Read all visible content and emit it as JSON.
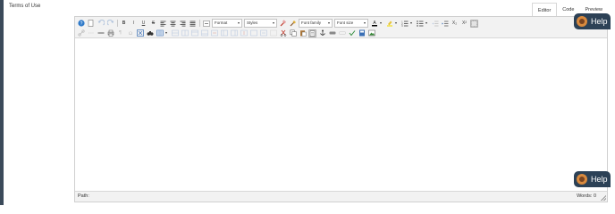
{
  "page": {
    "title": "Terms of Use"
  },
  "tabs": [
    {
      "label": "Editor",
      "active": true
    },
    {
      "label": "Code",
      "active": false
    },
    {
      "label": "Preview",
      "active": false
    }
  ],
  "toolbar": {
    "format_label": "Format",
    "styles_label": "Styles",
    "font_family_label": "Font family",
    "font_size_label": "Font size",
    "bold": "B",
    "italic": "I",
    "underline": "U",
    "strike": "S",
    "subscript": "X₂",
    "superscript": "X²",
    "paragraph": "¶"
  },
  "status": {
    "path_label": "Path:",
    "words_label": "Words: 0"
  },
  "help": {
    "label": "Help"
  },
  "colors": {
    "accent": "#2c4156",
    "sidebar": "#3b4a5a"
  }
}
